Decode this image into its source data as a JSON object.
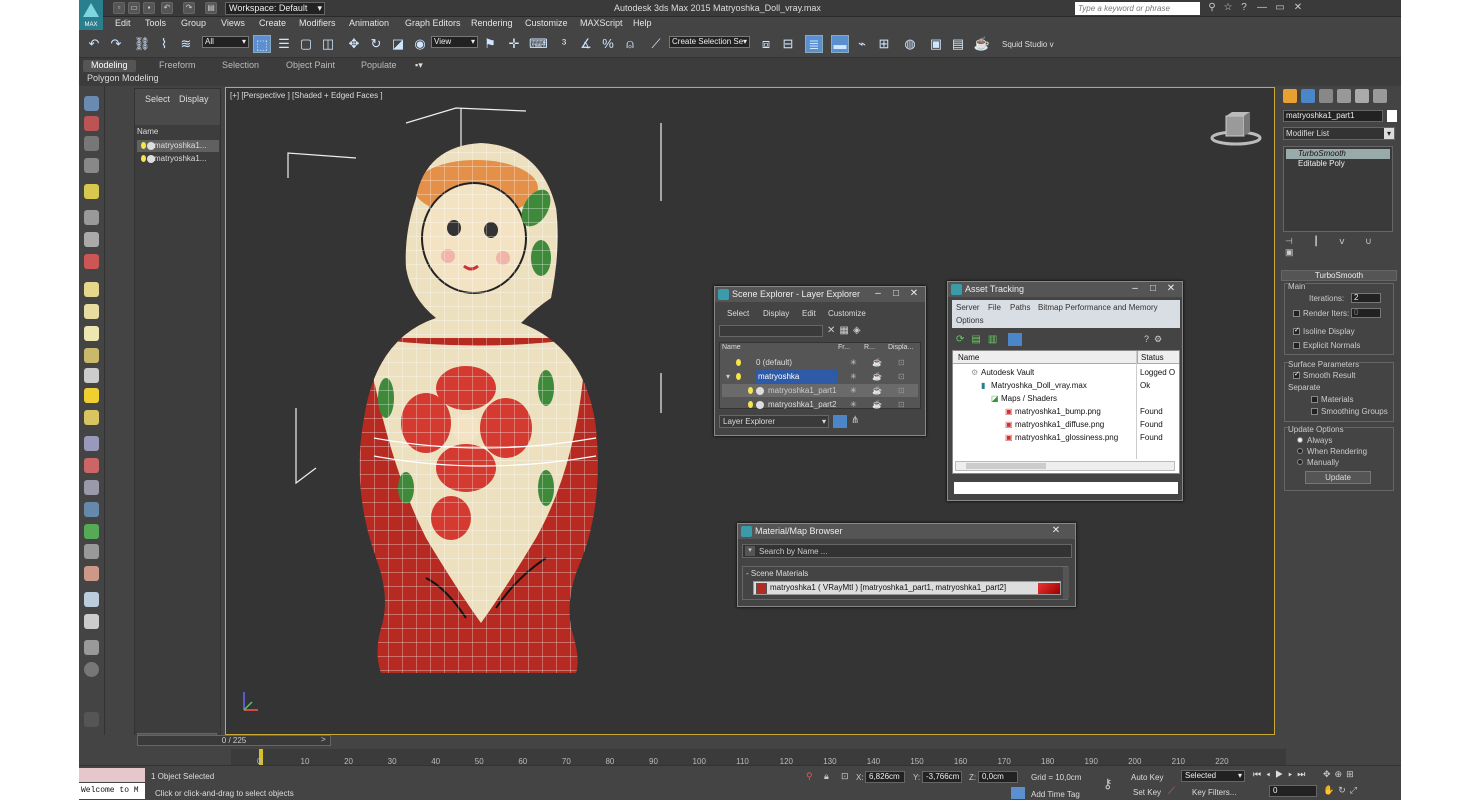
{
  "title_bar": {
    "workspace": "Workspace: Default",
    "window_title": "Autodesk 3ds Max  2015     Matryoshka_Doll_vray.max",
    "search_placeholder": "Type a keyword or phrase",
    "logo_text": "MAX"
  },
  "menu": [
    "Edit",
    "Tools",
    "Group",
    "Views",
    "Create",
    "Modifiers",
    "Animation",
    "Graph Editors",
    "Rendering",
    "Customize",
    "MAXScript",
    "Help"
  ],
  "toolbar": {
    "selection_filter": "All",
    "ref_coord": "View",
    "selection_set": "Create Selection Se",
    "studio_label": "Squid Studio v"
  },
  "ribbon": {
    "tabs": [
      "Modeling",
      "Freeform",
      "Selection",
      "Object Paint",
      "Populate"
    ],
    "subtitle": "Polygon Modeling"
  },
  "scene_explorer_panel": {
    "tabs": [
      "Select",
      "Display"
    ],
    "column": "Name",
    "items": [
      "matryoshka1...",
      "matryoshka1..."
    ]
  },
  "viewport": {
    "label": "[+] [Perspective ] [Shaded + Edged Faces ]"
  },
  "layer_explorer": {
    "title": "Scene Explorer - Layer Explorer",
    "menu": [
      "Select",
      "Display",
      "Edit",
      "Customize"
    ],
    "columns": [
      "Name",
      "Fr...",
      "R...",
      "Displa..."
    ],
    "rows": [
      "0 (default)",
      "matryoshka",
      "matryoshka1_part1",
      "matryoshka1_part2"
    ],
    "footer": "Layer Explorer"
  },
  "asset_tracking": {
    "title": "Asset Tracking",
    "menu": [
      "Server",
      "File",
      "Paths",
      "Bitmap Performance and Memory",
      "Options"
    ],
    "columns": [
      "Name",
      "Status"
    ],
    "rows": [
      {
        "name": "Autodesk Vault",
        "status": "Logged O"
      },
      {
        "name": "Matryoshka_Doll_vray.max",
        "status": "Ok"
      },
      {
        "name": "Maps / Shaders",
        "status": ""
      },
      {
        "name": "matryoshka1_bump.png",
        "status": "Found"
      },
      {
        "name": "matryoshka1_diffuse.png",
        "status": "Found"
      },
      {
        "name": "matryoshka1_glossiness.png",
        "status": "Found"
      }
    ]
  },
  "material_browser": {
    "title": "Material/Map Browser",
    "search_placeholder": "Search by Name ...",
    "group": "- Scene Materials",
    "item": "matryoshka1  ( VRayMtl )  [matryoshka1_part1, matryoshka1_part2]"
  },
  "command_panel": {
    "object_name": "matryoshka1_part1",
    "modifier_list": "Modifier List",
    "stack": [
      "TurboSmooth",
      "Editable Poly"
    ],
    "rollout_title": "TurboSmooth",
    "main_label": "Main",
    "iterations_label": "Iterations:",
    "iterations_value": "2",
    "render_iters_label": "Render Iters:",
    "render_iters_value": "0",
    "isoline": "Isoline Display",
    "explicit_normals": "Explicit Normals",
    "surface_params": "Surface Parameters",
    "smooth_result": "Smooth Result",
    "separate": "Separate",
    "materials": "Materials",
    "smoothing_groups": "Smoothing Groups",
    "update_options": "Update Options",
    "always": "Always",
    "when_rendering": "When Rendering",
    "manually": "Manually",
    "update_button": "Update"
  },
  "timeline": {
    "frame_counter": "0 / 225",
    "ticks": [
      "0",
      "10",
      "20",
      "30",
      "40",
      "50",
      "60",
      "70",
      "80",
      "90",
      "100",
      "110",
      "120",
      "130",
      "140",
      "150",
      "160",
      "170",
      "180",
      "190",
      "200",
      "210",
      "220"
    ]
  },
  "status_bar": {
    "selected": "1 Object Selected",
    "hint": "Click or click-and-drag to select objects",
    "maxscript": "Welcome to M",
    "x_label": "X:",
    "x_value": "6,826cm",
    "y_label": "Y:",
    "y_value": "-3,766cm",
    "z_label": "Z:",
    "z_value": "0,0cm",
    "grid": "Grid = 10,0cm",
    "add_time_tag": "Add Time Tag",
    "auto_key": "Auto Key",
    "set_key": "Set Key",
    "selected_dd": "Selected",
    "key_filters": "Key Filters...",
    "frame_value": "0"
  }
}
